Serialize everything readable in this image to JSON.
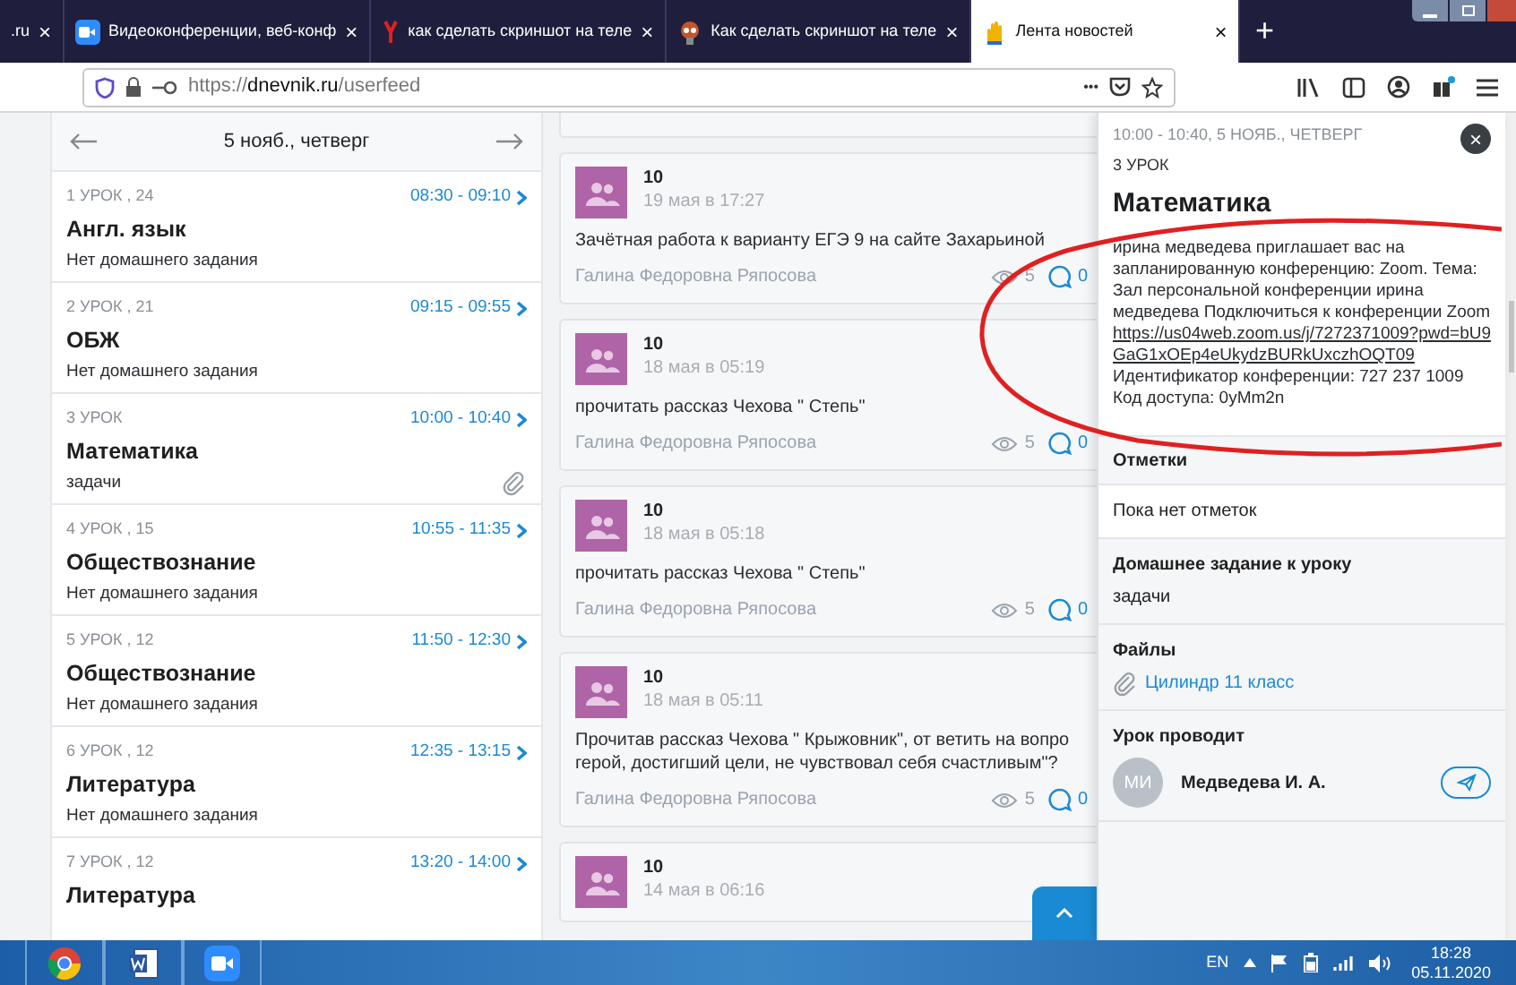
{
  "browser": {
    "tabs": [
      {
        "title": ".ru",
        "kind": "plain",
        "selected": false
      },
      {
        "title": "Видеоконференции, веб-конф",
        "kind": "camera",
        "selected": false
      },
      {
        "title": "как сделать скриншот на теле",
        "kind": "letter",
        "selected": false
      },
      {
        "title": "Как сделать скриншот на теле",
        "kind": "mascot",
        "selected": false
      },
      {
        "title": "Лента новостей",
        "kind": "site",
        "selected": true
      }
    ],
    "new_tab": "+",
    "close_glyph": "×",
    "address": {
      "scheme": "https://",
      "domain": "dnevnik.ru",
      "path": "/userfeed"
    },
    "menu_dots": "•••"
  },
  "schedule": {
    "date": "5 нояб., четверг",
    "lessons": [
      {
        "number": "1 УРОК , 24",
        "time": "08:30 - 09:10",
        "subject": "Англ. язык",
        "homework": "Нет домашнего задания",
        "has_files": false
      },
      {
        "number": "2 УРОК , 21",
        "time": "09:15 - 09:55",
        "subject": "ОБЖ",
        "homework": "Нет домашнего задания",
        "has_files": false
      },
      {
        "number": "3 УРОК",
        "time": "10:00 - 10:40",
        "subject": "Математика",
        "homework": "задачи",
        "has_files": true
      },
      {
        "number": "4 УРОК , 15",
        "time": "10:55 - 11:35",
        "subject": "Обществознание",
        "homework": "Нет домашнего задания",
        "has_files": false
      },
      {
        "number": "5 УРОК , 12",
        "time": "11:50 - 12:30",
        "subject": "Обществознание",
        "homework": "Нет домашнего задания",
        "has_files": false
      },
      {
        "number": "6 УРОК , 12",
        "time": "12:35 - 13:15",
        "subject": "Литература",
        "homework": "Нет домашнего задания",
        "has_files": false
      },
      {
        "number": "7 УРОК , 12",
        "time": "13:20 - 14:00",
        "subject": "Литература",
        "has_files": false
      }
    ]
  },
  "feed": {
    "posts": [
      {
        "group": "10",
        "date": "19 мая в 17:27",
        "text": "Зачётная работа  к варианту ЕГЭ 9 на сайте Захарьиной",
        "author": "Галина Федоровна Ряпосова",
        "views": "5",
        "comments": "0"
      },
      {
        "group": "10",
        "date": "18 мая в 05:19",
        "text": "прочитать рассказ Чехова \" Степь\"",
        "author": "Галина Федоровна Ряпосова",
        "views": "5",
        "comments": "0"
      },
      {
        "group": "10",
        "date": "18 мая в 05:18",
        "text": "прочитать рассказ Чехова \" Степь\"",
        "author": "Галина Федоровна Ряпосова",
        "views": "5",
        "comments": "0"
      },
      {
        "group": "10",
        "date": "18 мая в 05:11",
        "text": "Прочитав рассказ Чехова \" Крыжовник\", от ветить на вопро герой, достигший цели, не чувствовал себя счастливым\"?",
        "author": "Галина Федоровна Ряпосова",
        "views": "5",
        "comments": "0"
      },
      {
        "group": "10",
        "date": "14 мая в 06:16"
      }
    ]
  },
  "lesson_detail": {
    "when": "10:00 - 10:40, 5 НОЯБ., ЧЕТВЕРГ",
    "lesson": "3 УРОК",
    "subject": "Математика",
    "description_before": "ирина медведева приглашает вас на запланированную конференцию: Zoom. Тема: Зал персональной конференции ирина медведева Подключиться к конференции Zoom",
    "link": "https://us04web.zoom.us/j/7272371009?pwd=bU9GaG1xOEp4eUkydzBURkUxczhOQT09",
    "description_after": "Идентификатор конференции: 727 237 1009 Код доступа: 0yMm2n",
    "marks_title": "Отметки",
    "marks": "Пока нет отметок",
    "homework_title": "Домашнее задание к уроку",
    "homework": "задачи",
    "files_title": "Файлы",
    "file": "Цилиндр 11 класс",
    "teacher_title": "Урок проводит",
    "teacher_initials": "МИ",
    "teacher": "Медведева И. А."
  },
  "taskbar": {
    "apps": [
      {
        "kind": "chrome"
      },
      {
        "kind": "word"
      },
      {
        "kind": "zoom"
      }
    ],
    "language": "EN",
    "time": "18:28",
    "date": "05.11.2020"
  }
}
